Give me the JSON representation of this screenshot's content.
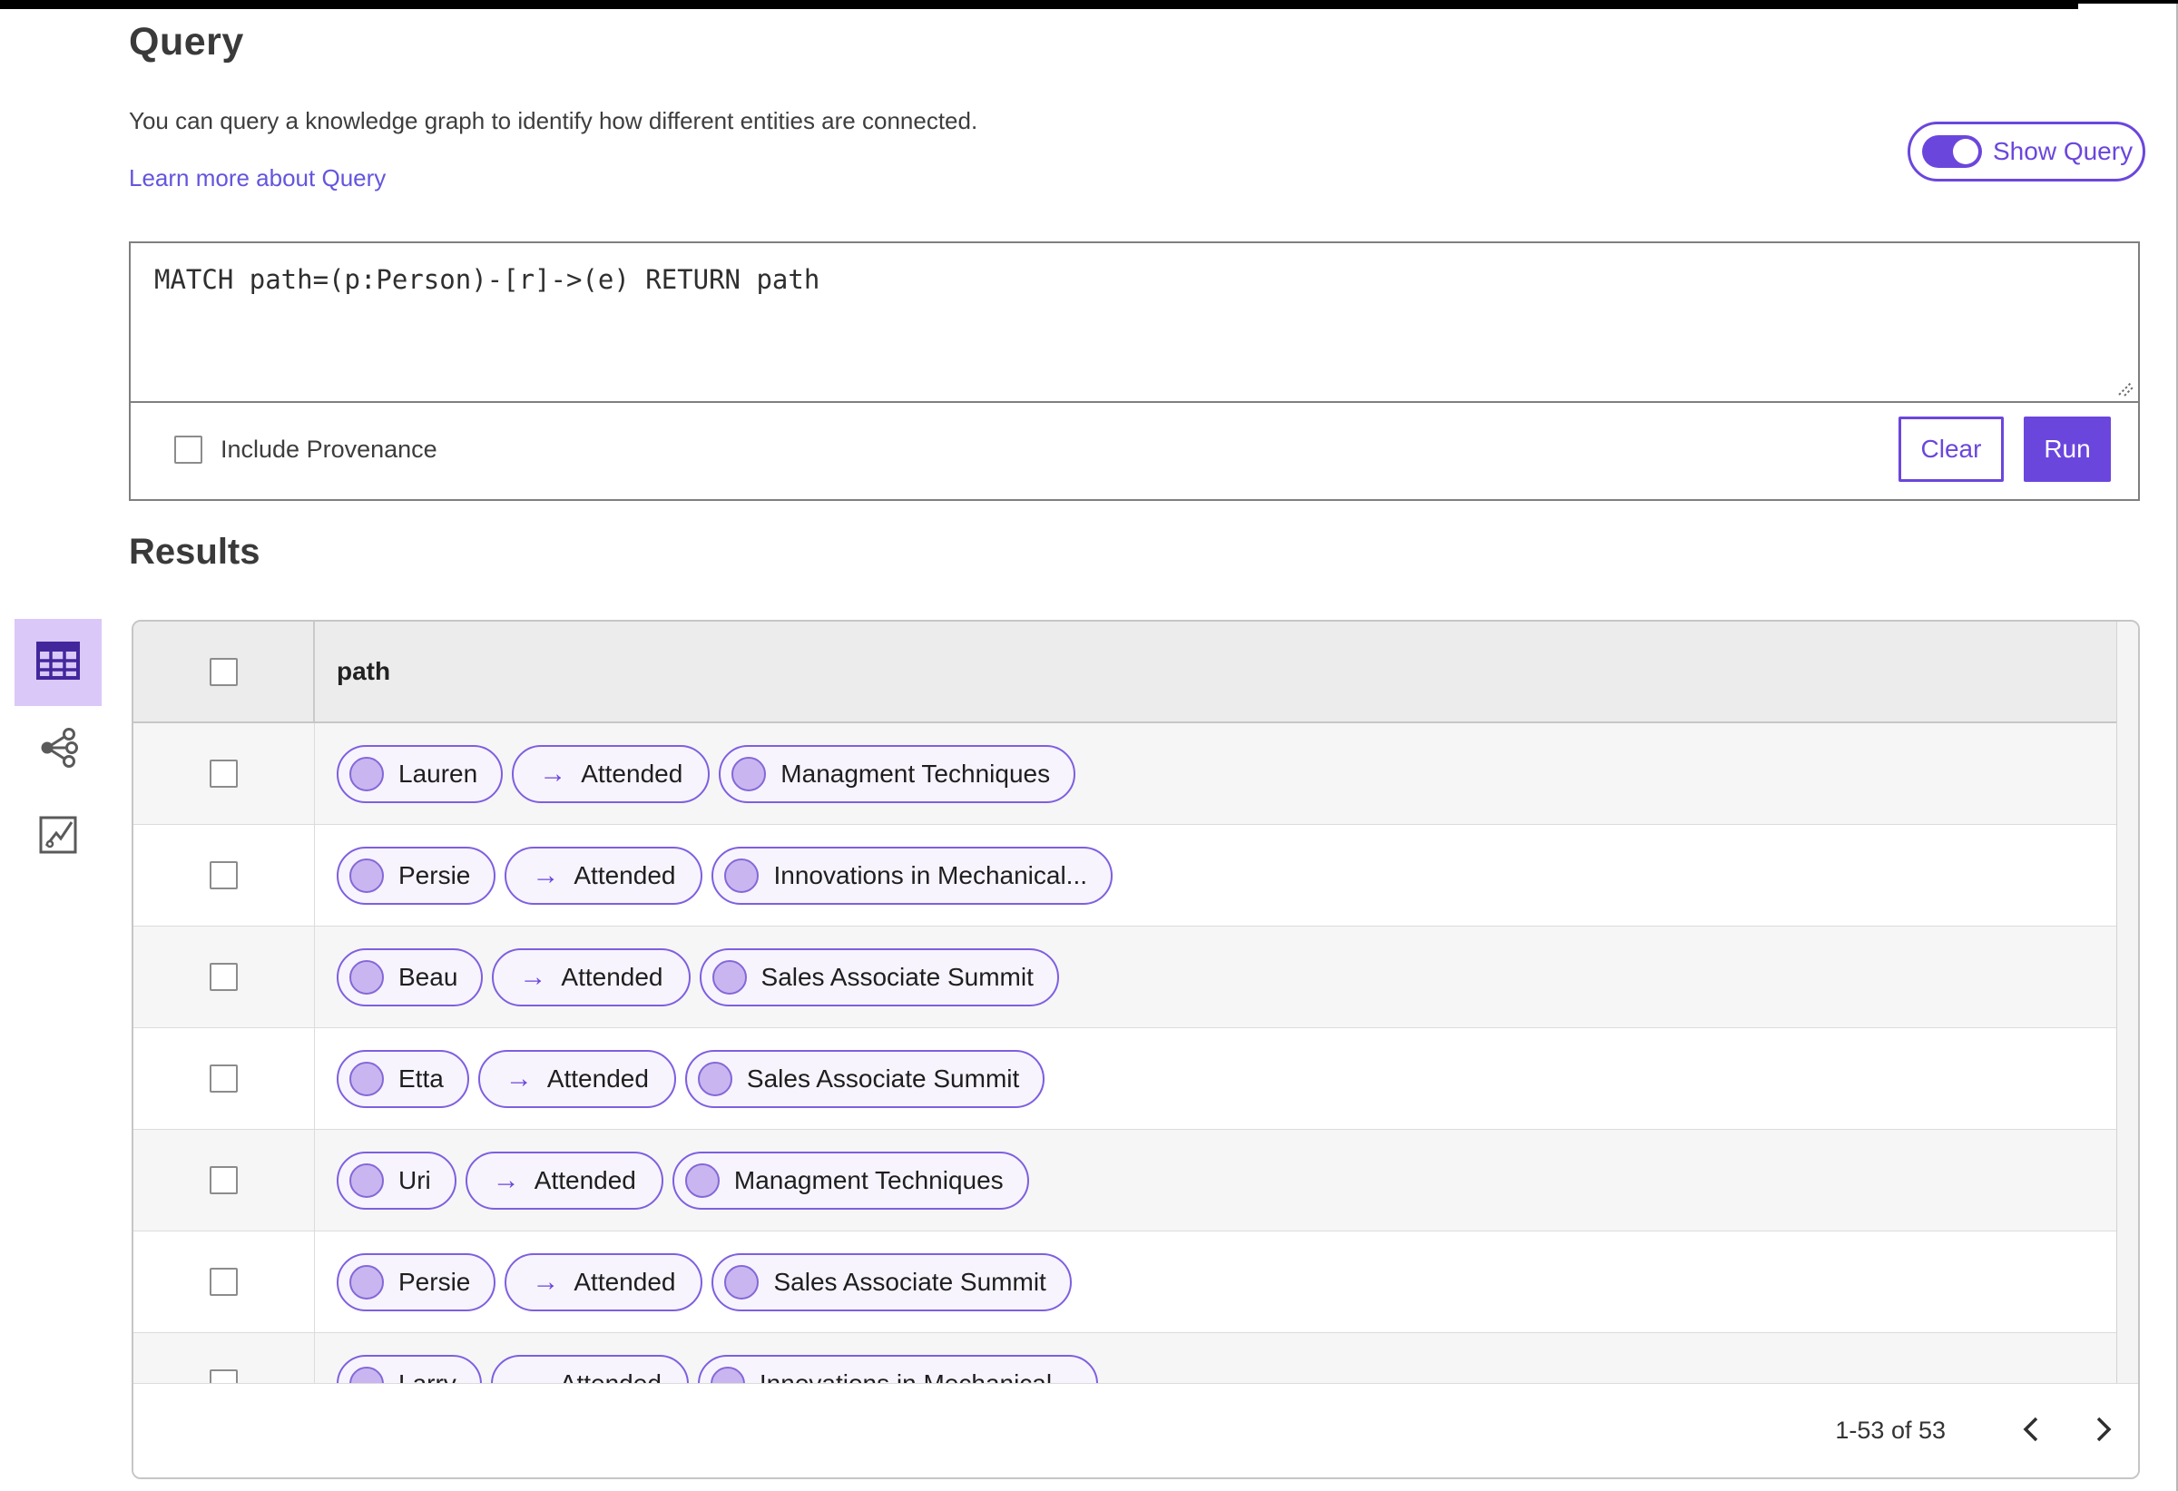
{
  "header": {
    "title": "Query",
    "description": "You can query a knowledge graph to identify how different entities are connected.",
    "learn_more": "Learn more about Query",
    "show_query": "Show Query",
    "show_query_state": "on"
  },
  "query": {
    "value": "MATCH path=(p:Person)-[r]->(e) RETURN path",
    "include_provenance": "Include Provenance",
    "include_provenance_checked": false,
    "clear": "Clear",
    "run": "Run"
  },
  "results": {
    "title": "Results",
    "column": "path",
    "rows": [
      {
        "source": "Lauren",
        "relation": "Attended",
        "target": "Managment Techniques"
      },
      {
        "source": "Persie",
        "relation": "Attended",
        "target": "Innovations in Mechanical..."
      },
      {
        "source": "Beau",
        "relation": "Attended",
        "target": "Sales Associate Summit"
      },
      {
        "source": "Etta",
        "relation": "Attended",
        "target": "Sales Associate Summit"
      },
      {
        "source": "Uri",
        "relation": "Attended",
        "target": "Managment Techniques"
      },
      {
        "source": "Persie",
        "relation": "Attended",
        "target": "Sales Associate Summit"
      },
      {
        "source": "Larry",
        "relation": "Attended",
        "target": "Innovations in Mechanical..."
      }
    ],
    "pagination": {
      "label": "1-53 of 53"
    }
  },
  "view_switcher": {
    "items": [
      {
        "id": "table-view",
        "icon": "table-icon",
        "active": true
      },
      {
        "id": "graph-view",
        "icon": "graph-icon",
        "active": false
      },
      {
        "id": "chart-view",
        "icon": "chart-icon",
        "active": false
      }
    ]
  },
  "icons": {
    "arrow_right": "→"
  },
  "colors": {
    "accent_purple": "#6b46dd",
    "pill_border": "#7e5fe0",
    "pill_background": "#f7f4fd",
    "node_circle_fill": "#c9b6f0",
    "active_view_background": "#d9c8f8",
    "table_header_background": "#ececec",
    "row_stripe_background": "#f6f6f6",
    "link_color": "#6355de"
  }
}
